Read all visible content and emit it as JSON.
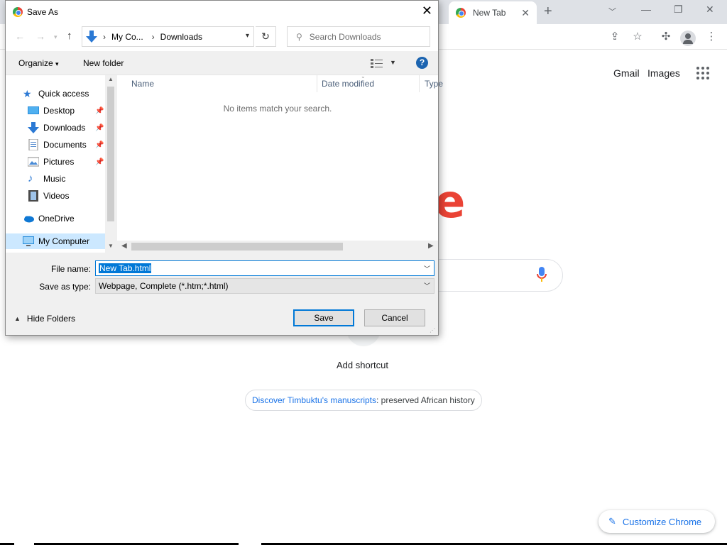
{
  "chrome": {
    "tab_title": "New Tab",
    "header_links": [
      "Gmail",
      "Images"
    ],
    "logo_fragment": "e",
    "add_shortcut": "Add shortcut",
    "discover": {
      "link": "Discover Timbuktu's manuscripts",
      "rest": ": preserved African history"
    },
    "customize": "Customize Chrome",
    "icons": [
      "new-tab-plus-icon",
      "minimize-icon",
      "restore-icon",
      "close-icon",
      "share-icon",
      "bookmark-star-icon",
      "extensions-icon",
      "profile-icon",
      "menu-dots-icon",
      "apps-grid-icon",
      "mic-icon",
      "pencil-icon"
    ]
  },
  "dialog": {
    "title": "Save As",
    "address": {
      "segments": [
        "My Co...",
        "Downloads"
      ]
    },
    "search_placeholder": "Search Downloads",
    "commands": {
      "organize": "Organize",
      "new_folder": "New folder"
    },
    "nav_items": [
      {
        "label": "Quick access",
        "icon": "star-icon"
      },
      {
        "label": "Desktop",
        "icon": "desktop-icon",
        "pinned": true
      },
      {
        "label": "Downloads",
        "icon": "download-arrow-icon",
        "pinned": true
      },
      {
        "label": "Documents",
        "icon": "document-icon",
        "pinned": true
      },
      {
        "label": "Pictures",
        "icon": "picture-icon",
        "pinned": true
      },
      {
        "label": "Music",
        "icon": "music-note-icon"
      },
      {
        "label": "Videos",
        "icon": "film-icon"
      },
      {
        "label": "OneDrive",
        "icon": "cloud-icon"
      },
      {
        "label": "My Computer",
        "icon": "monitor-icon",
        "selected": true
      }
    ],
    "columns": [
      "Name",
      "Date modified",
      "Type"
    ],
    "empty_message": "No items match your search.",
    "file_name_label": "File name:",
    "file_name_value": "New Tab.html",
    "save_type_label": "Save as type:",
    "save_type_value": "Webpage, Complete (*.htm;*.html)",
    "hide_folders": "Hide Folders",
    "save_button": "Save",
    "cancel_button": "Cancel",
    "accent": "#0078d7"
  }
}
